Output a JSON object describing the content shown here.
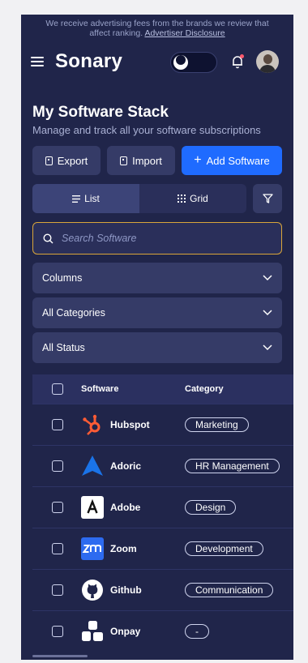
{
  "disclosure": {
    "line1": "We receive advertising fees from the brands we review that",
    "line2_text": "affect ranking. ",
    "link": "Advertiser Disclosure"
  },
  "header": {
    "logo": "Sonary"
  },
  "page": {
    "title": "My Software Stack",
    "subtitle": "Manage and track all your software subscriptions"
  },
  "actions": {
    "export_label": "Export",
    "import_label": "Import",
    "add_label": "Add Software"
  },
  "view": {
    "list_label": "List",
    "grid_label": "Grid",
    "active": "list"
  },
  "search": {
    "placeholder": "Search Software",
    "value": ""
  },
  "filters": {
    "columns": "Columns",
    "categories": "All Categories",
    "status": "All Status"
  },
  "table": {
    "headers": {
      "software": "Software",
      "category": "Category"
    },
    "rows": [
      {
        "name": "Hubspot",
        "category": "Marketing",
        "icon": "hubspot-icon"
      },
      {
        "name": "Adoric",
        "category": "HR Management",
        "icon": "adoric-icon"
      },
      {
        "name": "Adobe",
        "category": "Design",
        "icon": "adobe-icon"
      },
      {
        "name": "Zoom",
        "category": "Development",
        "icon": "zoom-icon"
      },
      {
        "name": "Github",
        "category": "Communication",
        "icon": "github-icon"
      },
      {
        "name": "Onpay",
        "category": "-",
        "icon": "onpay-icon"
      }
    ]
  },
  "colors": {
    "background": "#20254a",
    "accent": "#1f6bff",
    "search_border": "#d9a53a",
    "hubspot": "#ff5c35",
    "adoric": "#1a73e8",
    "zoom": "#2d6bf0"
  }
}
